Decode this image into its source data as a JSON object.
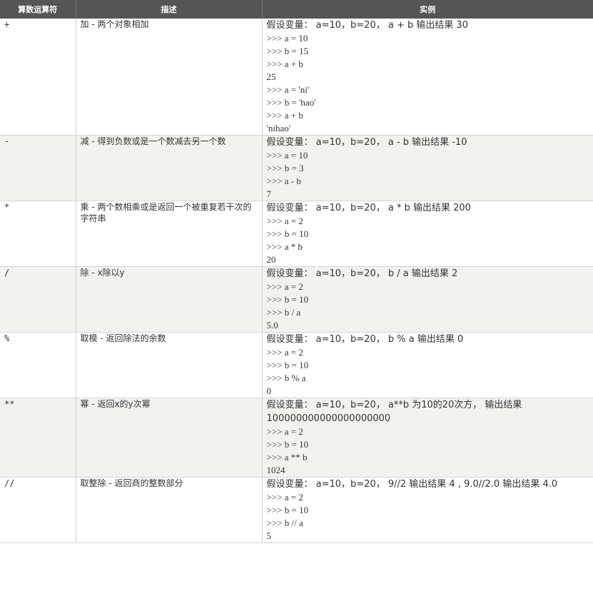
{
  "headers": [
    "算数运算符",
    "描述",
    "实例"
  ],
  "rows": [
    {
      "op": "+",
      "desc": "加 - 两个对象相加",
      "lead": "假设变量： a=10，b=20， a + b 输出结果 30",
      "lines": [
        ">>> a = 10",
        ">>> b = 15",
        ">>> a + b",
        "25",
        ">>> a = 'ni'",
        ">>> b = 'hao'",
        ">>> a + b",
        "'nihao'"
      ]
    },
    {
      "op": "-",
      "desc": "减 - 得到负数或是一个数减去另一个数",
      "lead": "假设变量： a=10，b=20， a - b 输出结果 -10",
      "lines": [
        ">>> a = 10",
        ">>> b = 3",
        ">>> a - b",
        "7"
      ]
    },
    {
      "op": "*",
      "desc": "乘 - 两个数相乘或是返回一个被重复若干次的字符串",
      "lead": "假设变量： a=10，b=20， a * b 输出结果 200",
      "lines": [
        ">>> a = 2",
        ">>> b = 10",
        ">>> a * b",
        "20"
      ]
    },
    {
      "op": "/",
      "desc": "除 - x除以y",
      "lead": "假设变量： a=10，b=20， b / a 输出结果 2",
      "lines": [
        ">>> a = 2",
        ">>> b = 10",
        ">>> b / a",
        "5.0"
      ]
    },
    {
      "op": "%",
      "desc": "取模 - 返回除法的余数",
      "lead": "假设变量： a=10，b=20， b % a 输出结果 0",
      "lines": [
        ">>> a = 2",
        ">>> b = 10",
        ">>> b % a",
        "0"
      ]
    },
    {
      "op": "**",
      "desc": "幂 - 返回x的y次幂",
      "lead": "假设变量： a=10，b=20， a**b 为10的20次方， 输出结果 100000000000000000000",
      "lines": [
        ">>> a = 2",
        ">>> b = 10",
        ">>> a ** b",
        "1024"
      ]
    },
    {
      "op": "//",
      "desc": "取整除 - 返回商的整数部分",
      "lead": "假设变量： a=10，b=20， 9//2 输出结果 4 , 9.0//2.0 输出结果 4.0",
      "lines": [
        ">>> a = 2",
        ">>> b = 10",
        ">>> b // a",
        "5"
      ]
    }
  ]
}
